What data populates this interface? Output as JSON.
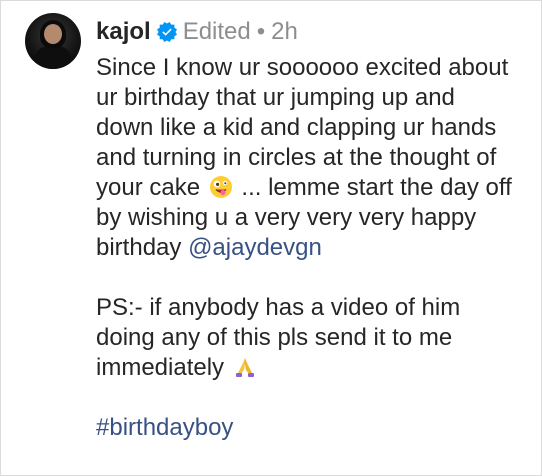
{
  "post": {
    "username": "kajol",
    "status": "Edited",
    "separator": "•",
    "time": "2h",
    "caption": {
      "line1": "Since I know ur soooooo excited about",
      "line2": "ur birthday that ur jumping up and",
      "line3": "down like a kid and clapping ur hands",
      "line4": "and turning in circles at the thought of",
      "line5_a": "your cake",
      "line5_b": "... lemme start the day off",
      "line6": "by wishing u a very very very happy",
      "line7_a": "birthday",
      "mention": "@ajaydevgn",
      "ps_line1": "PS:- if anybody has a video of him",
      "ps_line2": "doing any of this pls send it to me",
      "ps_line3": "immediately",
      "hashtag": "#birthdayboy"
    },
    "icons": {
      "verified": "verified-badge-icon",
      "emoji_face": "zany-face-emoji",
      "emoji_hands": "folded-hands-emoji"
    },
    "colors": {
      "verified": "#0095f6",
      "link": "#385185",
      "meta": "#8e8e8e"
    }
  }
}
